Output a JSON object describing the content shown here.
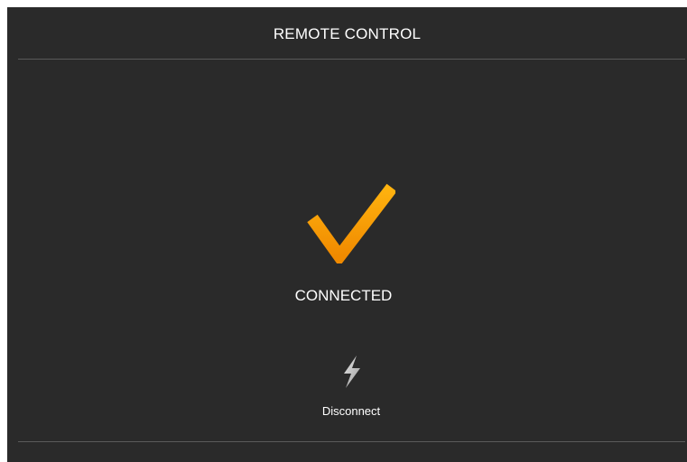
{
  "header": {
    "title": "REMOTE CONTROL"
  },
  "status": {
    "label": "CONNECTED",
    "icon": "checkmark-icon",
    "accent_color": "#F5A10A"
  },
  "actions": {
    "disconnect_label": "Disconnect",
    "disconnect_icon": "lightning-bolt-icon"
  },
  "theme": {
    "background": "#2A2A2A",
    "divider": "#5A5A5A",
    "text": "#FFFFFF"
  }
}
